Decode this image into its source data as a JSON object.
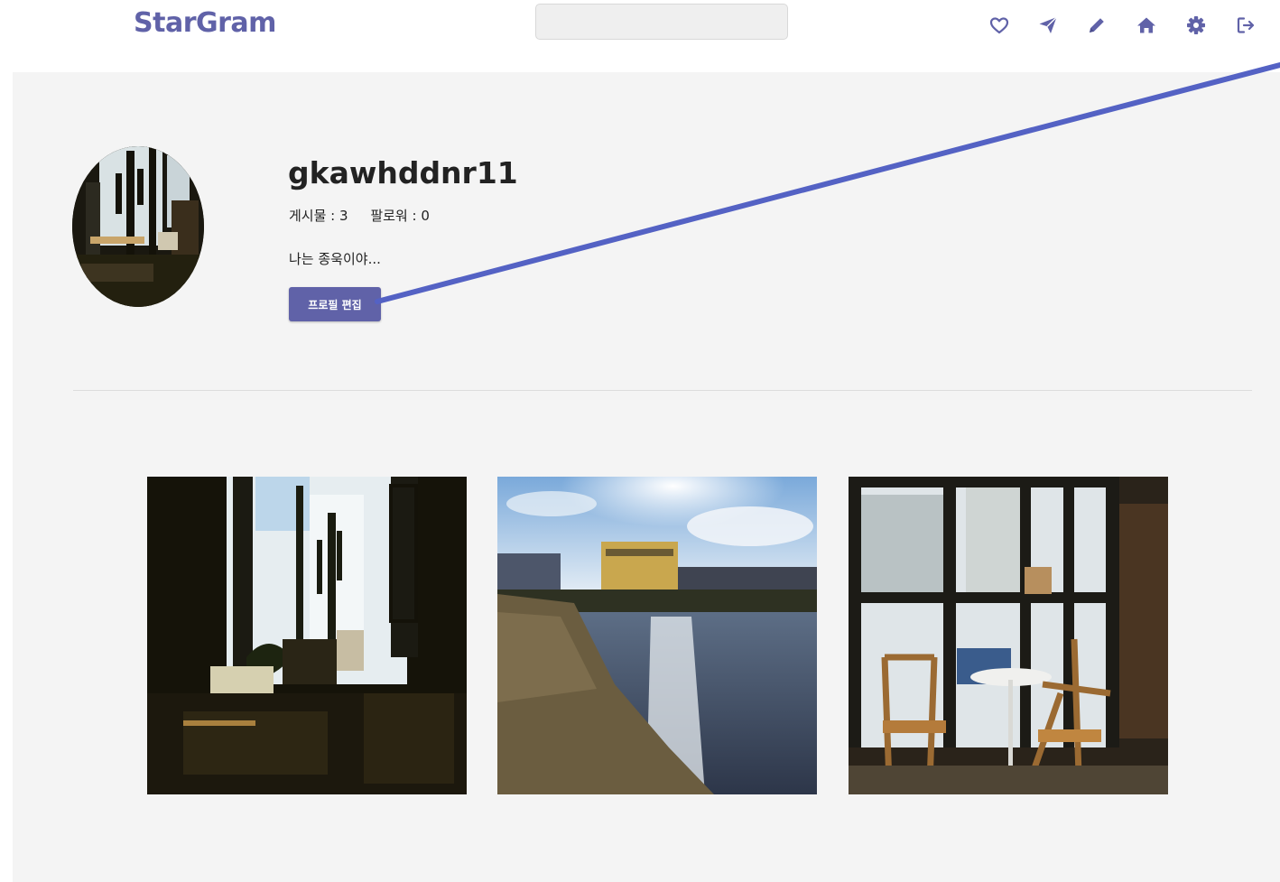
{
  "header": {
    "logo": "StarGram",
    "search": {
      "value": "",
      "placeholder": ""
    },
    "nav_icons": [
      "heart-icon",
      "paper-plane-icon",
      "pencil-icon",
      "home-icon",
      "gear-icon",
      "logout-icon"
    ]
  },
  "profile": {
    "username": "gkawhddnr11",
    "posts_label": "게시물 : 3",
    "followers_label": "팔로워 : 0",
    "bio": "나는 종욱이야...",
    "edit_button": "프로필 편집"
  },
  "posts": [
    {
      "name": "cafe-interior-cactus"
    },
    {
      "name": "seaside-sunset"
    },
    {
      "name": "cafe-window-chairs"
    }
  ],
  "colors": {
    "brand": "#6062a8",
    "annotation": "#5462c4",
    "panel": "#f4f4f4"
  }
}
